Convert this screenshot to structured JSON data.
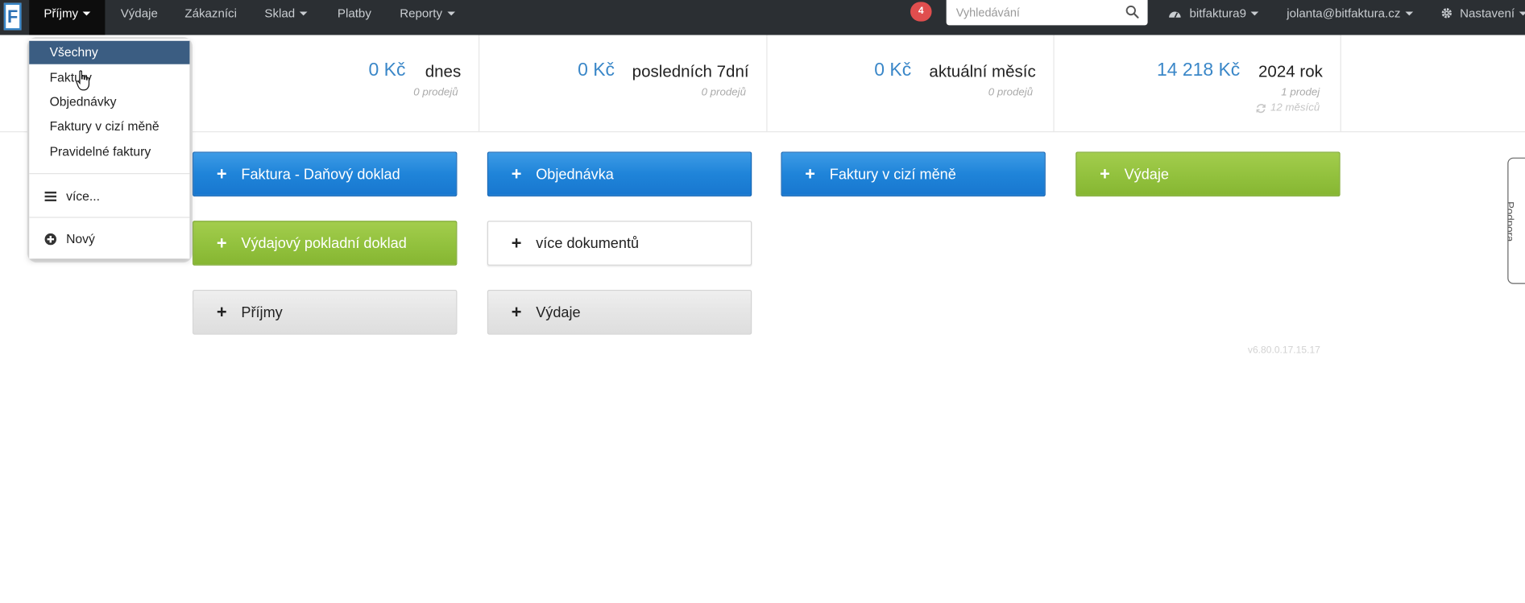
{
  "navbar": {
    "logo": "F",
    "items": [
      {
        "label": "Příjmy",
        "has_caret": true,
        "active": true
      },
      {
        "label": "Výdaje",
        "has_caret": false
      },
      {
        "label": "Zákazníci",
        "has_caret": false
      },
      {
        "label": "Sklad",
        "has_caret": true
      },
      {
        "label": "Platby",
        "has_caret": false
      },
      {
        "label": "Reporty",
        "has_caret": true
      }
    ],
    "notification_count": "4",
    "search_placeholder": "Vyhledávání",
    "account_label": "bitfaktura9",
    "user_label": "jolanta@bitfaktura.cz",
    "settings_label": "Nastavení"
  },
  "dropdown": {
    "items": [
      "Všechny",
      "Faktury",
      "Objednávky",
      "Faktury v cizí měně",
      "Pravidelné faktury"
    ],
    "selected_index": 0,
    "more_label": "více...",
    "new_label": "Nový"
  },
  "stats": [
    {
      "amount": "0 Kč",
      "period": "dnes",
      "sales": "0 prodejů"
    },
    {
      "amount": "0 Kč",
      "period": "posledních 7dní",
      "sales": "0 prodejů"
    },
    {
      "amount": "0 Kč",
      "period": "aktuální měsíc",
      "sales": "0 prodejů"
    },
    {
      "amount": "14 218 Kč",
      "period": "2024 rok",
      "sales": "1 prodej",
      "extra": "12 měsíců"
    }
  ],
  "buttons": {
    "invoice": "Faktura - Daňový doklad",
    "order": "Objednávka",
    "foreign_invoice": "Faktury v cizí měně",
    "expense": "Výdaje",
    "expense_receipt": "Výdajový pokladní doklad",
    "more_documents": "více dokumentů",
    "income": "Příjmy",
    "expenses": "Výdaje",
    "plus": "+"
  },
  "version": "v6.80.0.17.15.17",
  "side_tab": "Podpora",
  "colors": {
    "navbar": "#2b2f33",
    "accent_blue": "#1f84d9",
    "accent_green": "#92c13d",
    "stat_blue": "#3a87c8",
    "badge_red": "#e04e4e",
    "menu_selected": "#3b5d82"
  }
}
